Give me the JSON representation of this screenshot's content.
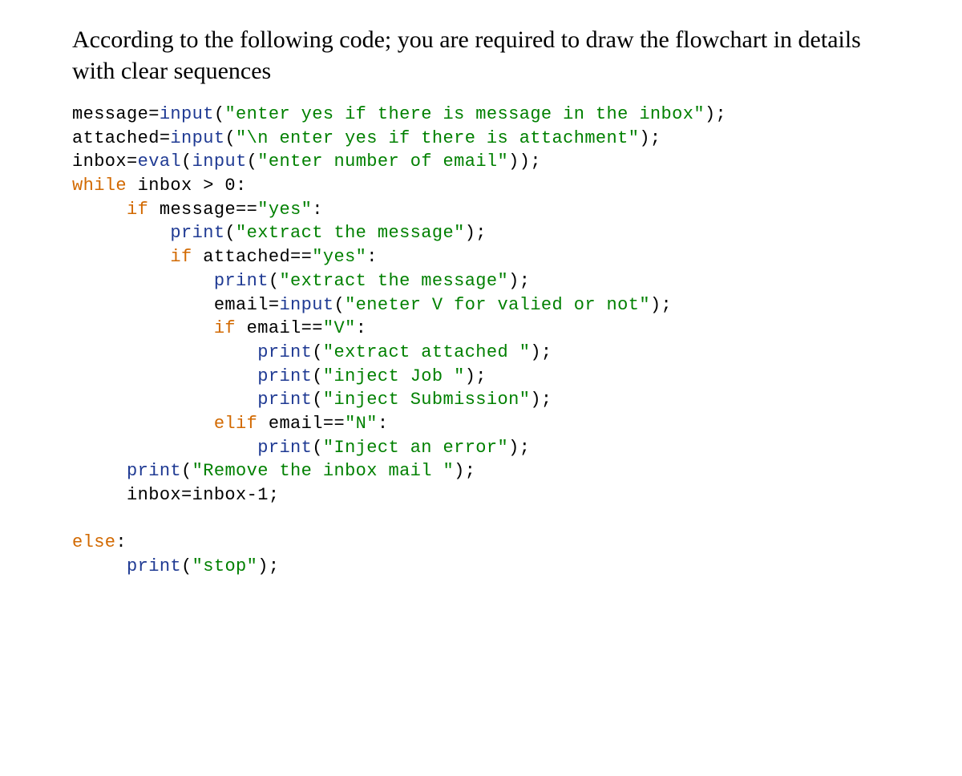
{
  "heading": "According to the following code; you are required to draw the flowchart in details with clear sequences",
  "code": {
    "l1": {
      "var": "message=",
      "fn": "input",
      "open": "(",
      "str": "\"enter yes if there is message in the inbox\"",
      "close": ");"
    },
    "l2": {
      "var": "attached=",
      "fn": "input",
      "open": "(",
      "str": "\"\\n enter yes if there is attachment\"",
      "close": ");"
    },
    "l3": {
      "var": "inbox=",
      "fn1": "eval",
      "open1": "(",
      "fn2": "input",
      "open2": "(",
      "str": "\"enter number of email\"",
      "close": "));"
    },
    "l4": {
      "kw": "while",
      "rest": " inbox > 0:"
    },
    "l5": {
      "indent": "     ",
      "kw": "if",
      "mid": " message==",
      "str": "\"yes\"",
      "colon": ":"
    },
    "l6": {
      "indent": "         ",
      "fn": "print",
      "open": "(",
      "str": "\"extract the message\"",
      "close": ");"
    },
    "l7": {
      "indent": "         ",
      "kw": "if",
      "mid": " attached==",
      "str": "\"yes\"",
      "colon": ":"
    },
    "l8": {
      "indent": "             ",
      "fn": "print",
      "open": "(",
      "str": "\"extract the message\"",
      "close": ");"
    },
    "l9": {
      "indent": "             ",
      "var": "email=",
      "fn": "input",
      "open": "(",
      "str": "\"eneter V for valied or not\"",
      "close": ");"
    },
    "l10": {
      "indent": "             ",
      "kw": "if",
      "mid": " email==",
      "str": "\"V\"",
      "colon": ":"
    },
    "l11": {
      "indent": "                 ",
      "fn": "print",
      "open": "(",
      "str": "\"extract attached \"",
      "close": ");"
    },
    "l12": {
      "indent": "                 ",
      "fn": "print",
      "open": "(",
      "str": "\"inject Job \"",
      "close": ");"
    },
    "l13": {
      "indent": "                 ",
      "fn": "print",
      "open": "(",
      "str": "\"inject Submission\"",
      "close": ");"
    },
    "l14": {
      "indent": "             ",
      "kw": "elif",
      "mid": " email==",
      "str": "\"N\"",
      "colon": ":"
    },
    "l15": {
      "indent": "                 ",
      "fn": "print",
      "open": "(",
      "str": "\"Inject an error\"",
      "close": ");"
    },
    "l16": {
      "indent": "     ",
      "fn": "print",
      "open": "(",
      "str": "\"Remove the inbox mail \"",
      "close": ");"
    },
    "l17": {
      "indent": "     ",
      "rest": "inbox=inbox-1;"
    },
    "blank": " ",
    "l18": {
      "kw": "else",
      "colon": ":"
    },
    "l19": {
      "indent": "     ",
      "fn": "print",
      "open": "(",
      "str": "\"stop\"",
      "close": ");"
    }
  }
}
